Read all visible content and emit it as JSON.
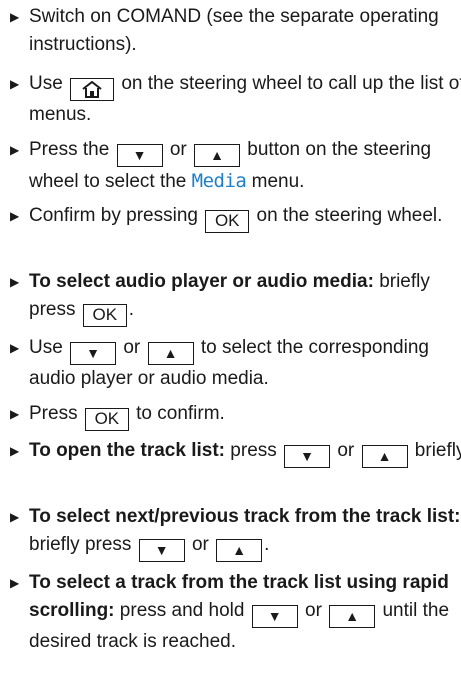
{
  "keys": {
    "ok": "OK",
    "down": "▼",
    "up": "▲"
  },
  "accent_color": "#1f7fc8",
  "home_key_icon": "home-icon",
  "items": [
    {
      "text": "Switch on COMAND (see the separate operating instructions)."
    },
    {
      "pre": "Use",
      "post": "on the steering wheel to call up the list of menus."
    },
    {
      "pre": "Press the",
      "mid": "or",
      "post1": "button on the steering wheel to select the",
      "media": "Media",
      "post2": "menu."
    },
    {
      "pre": "Confirm by pressing",
      "post": "on the steering wheel."
    },
    {
      "bold": "To select audio player or audio media:",
      "pre": "briefly press",
      "post": "."
    },
    {
      "pre": "Use",
      "mid": "or",
      "post": "to select the corresponding audio player or audio media."
    },
    {
      "pre": "Press",
      "post": "to confirm."
    },
    {
      "bold": "To open the track list:",
      "pre": "press",
      "mid": "or",
      "post": "briefly."
    },
    {
      "bold": "To select next/previous track from the track list:",
      "pre": "briefly press",
      "mid": "or",
      "post": "."
    },
    {
      "bold": "To select a track from the track list using rapid scrolling:",
      "pre": "press and hold",
      "mid": "or",
      "post": "until the desired track is reached."
    }
  ]
}
